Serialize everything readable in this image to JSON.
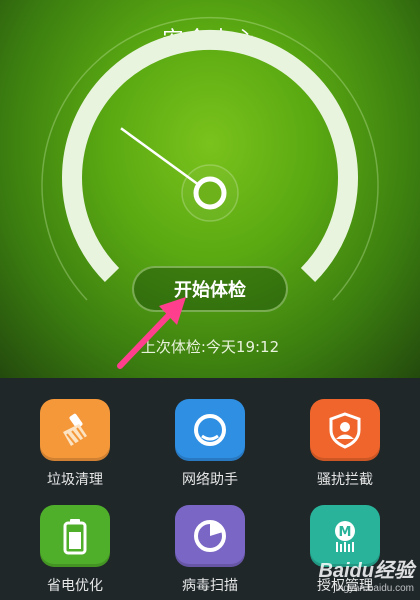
{
  "header": {
    "title": "安全中心"
  },
  "gauge": {
    "needle_value": 0.3
  },
  "start_button": {
    "label": "开始体检"
  },
  "last_check": {
    "text": "上次体检:今天19:12"
  },
  "tiles": [
    {
      "label": "垃圾清理",
      "icon": "broom-icon",
      "color": "#f5983a"
    },
    {
      "label": "网络助手",
      "icon": "network-icon",
      "color": "#2f8fe3"
    },
    {
      "label": "骚扰拦截",
      "icon": "shield-user-icon",
      "color": "#f0652b"
    },
    {
      "label": "省电优化",
      "icon": "battery-icon",
      "color": "#4fae2a"
    },
    {
      "label": "病毒扫描",
      "icon": "virus-scan-icon",
      "color": "#7a66c4"
    },
    {
      "label": "授权管理",
      "icon": "permission-icon",
      "color": "#28b39a"
    }
  ],
  "watermark": {
    "brand": "Baidu经验",
    "url": "jingyan.baidu.com"
  },
  "colors": {
    "accent": "#6bb81a",
    "arrow": "#ff3f8e"
  }
}
